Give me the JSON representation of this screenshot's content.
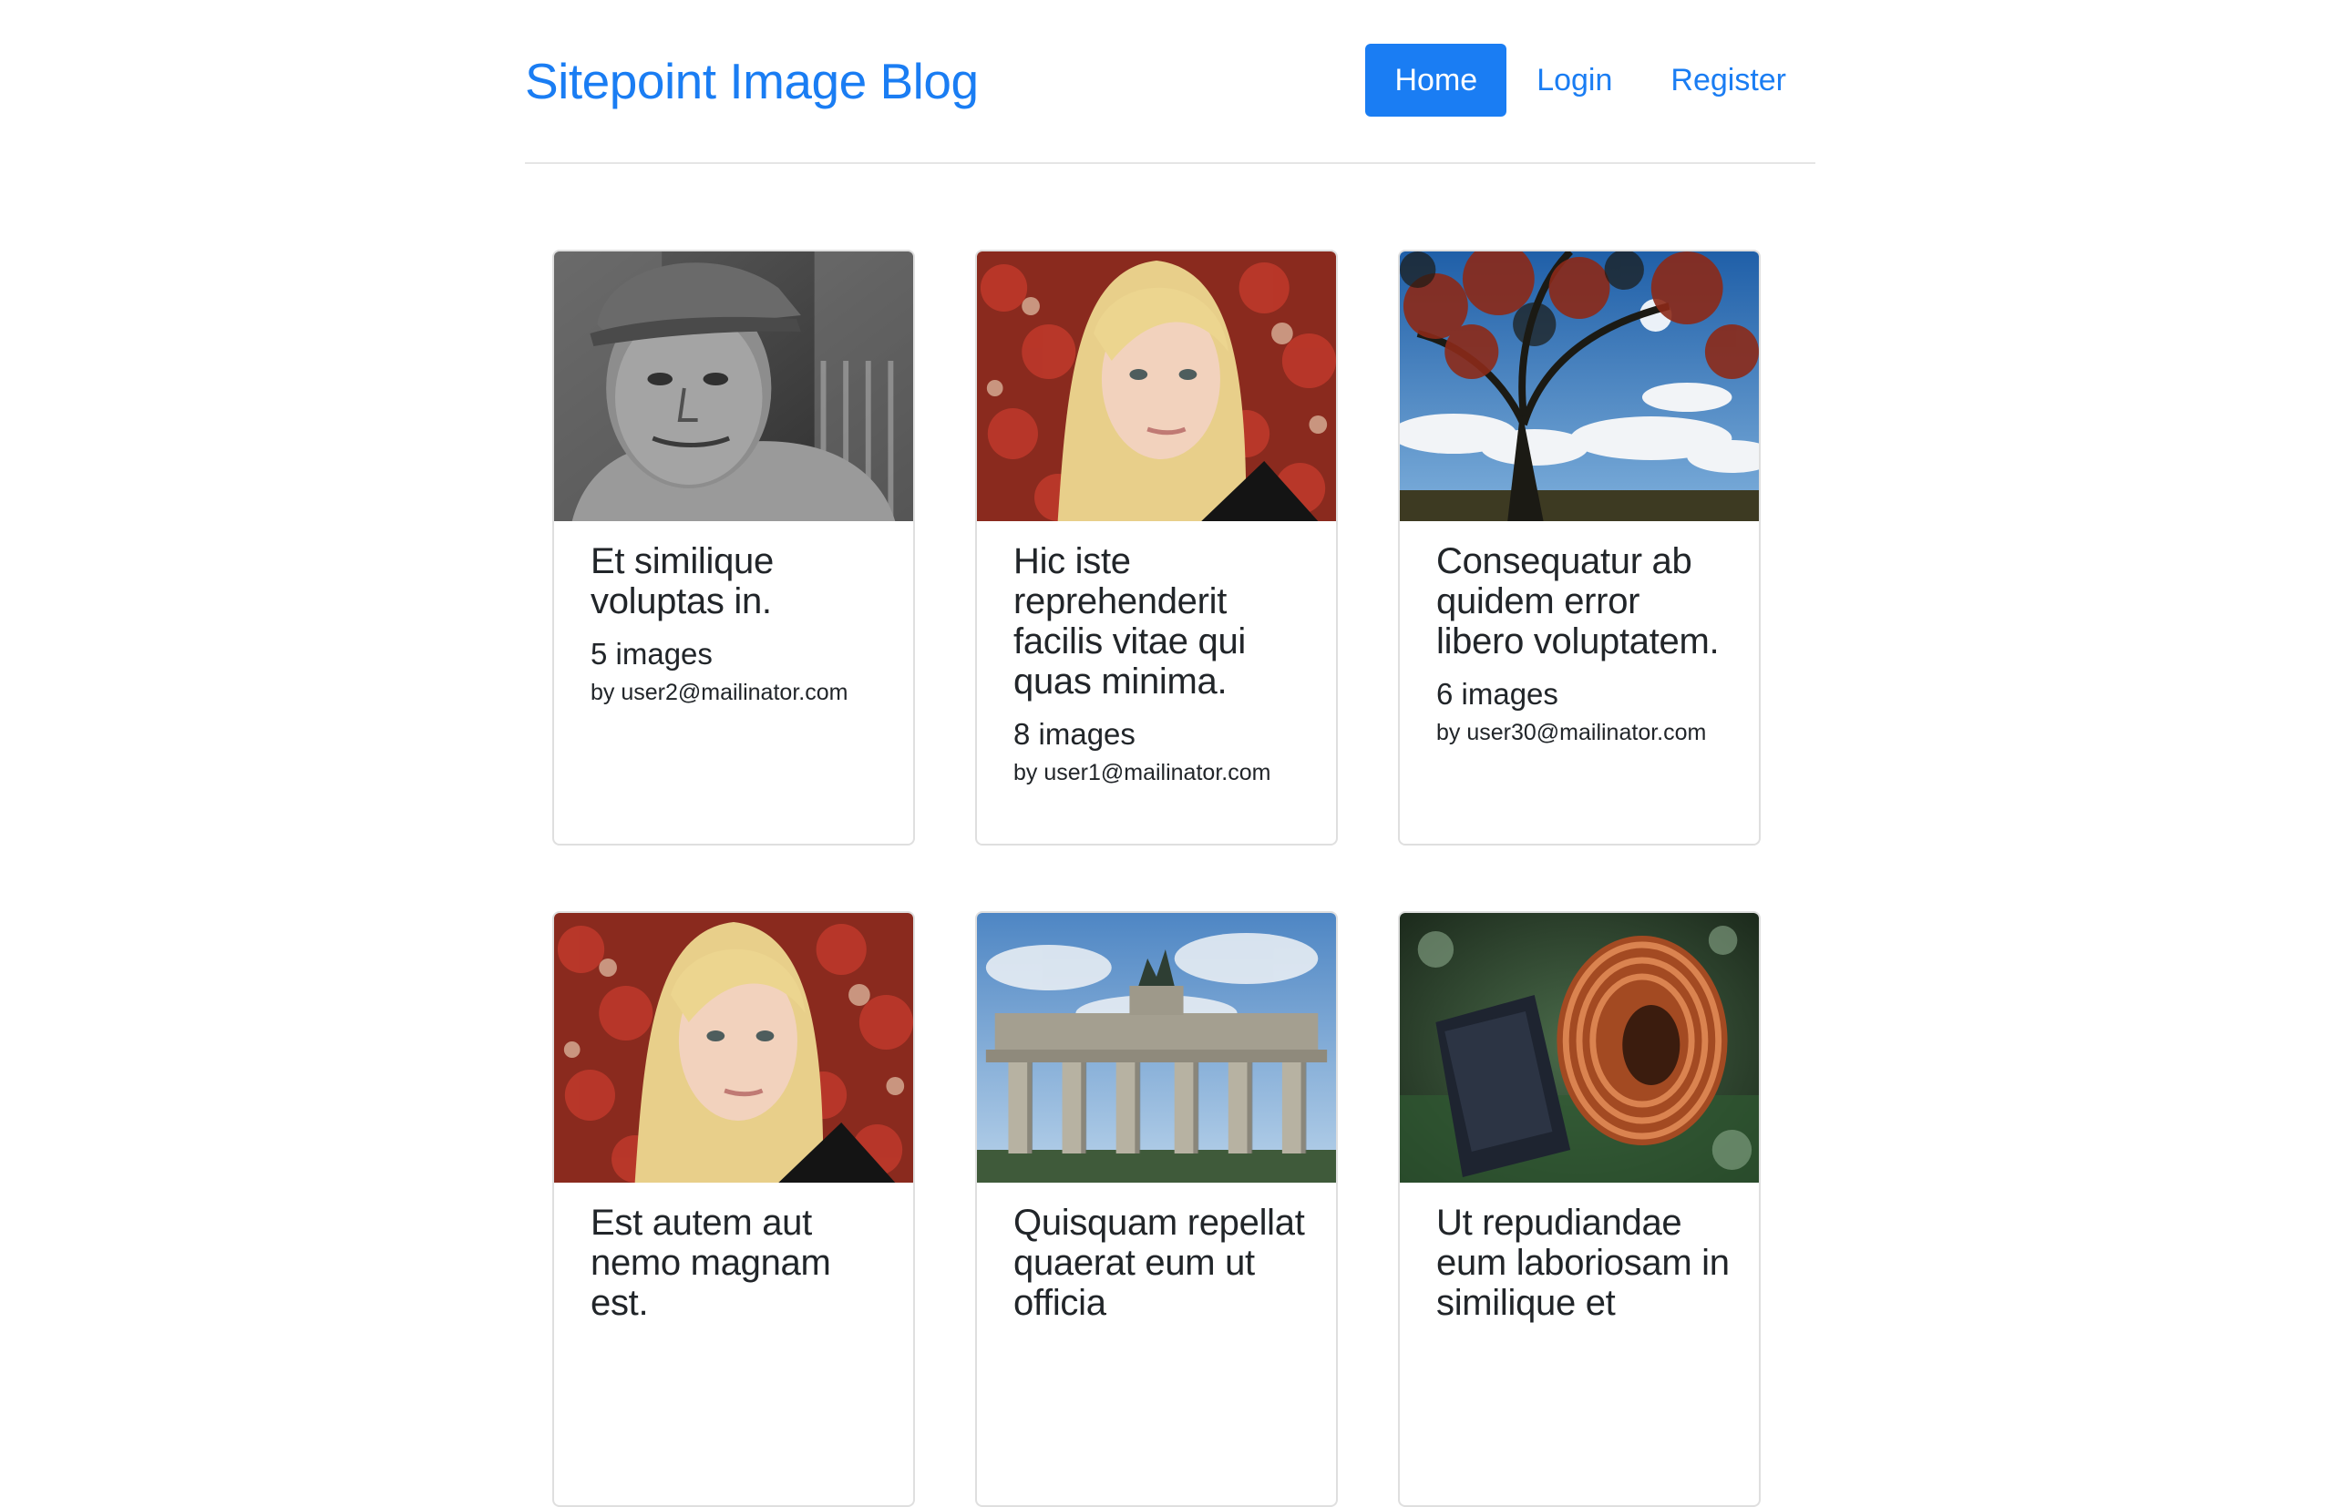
{
  "brand": "Sitepoint Image Blog",
  "nav": {
    "home": "Home",
    "login": "Login",
    "register": "Register"
  },
  "galleries": [
    {
      "title": "Et similique voluptas in.",
      "count": "5 images",
      "author": "by user2@mailinator.com",
      "image": "portrait-old-man"
    },
    {
      "title": "Hic iste reprehenderit facilis vitae qui quas minima.",
      "count": "8 images",
      "author": "by user1@mailinator.com",
      "image": "portrait-blonde-woman"
    },
    {
      "title": "Consequatur ab quidem error libero voluptatem.",
      "count": "6 images",
      "author": "by user30@mailinator.com",
      "image": "autumn-tree"
    },
    {
      "title": "Est autem aut nemo magnam est.",
      "count": "",
      "author": "",
      "image": "portrait-blonde-woman"
    },
    {
      "title": "Quisquam repellat quaerat eum ut officia",
      "count": "",
      "author": "",
      "image": "brandenburg-gate"
    },
    {
      "title": "Ut repudiandae eum laboriosam in similique et",
      "count": "",
      "author": "",
      "image": "copper-coil"
    }
  ],
  "colors": {
    "accent": "#1a7df3",
    "text": "#212529",
    "border": "#dfdfdf"
  }
}
